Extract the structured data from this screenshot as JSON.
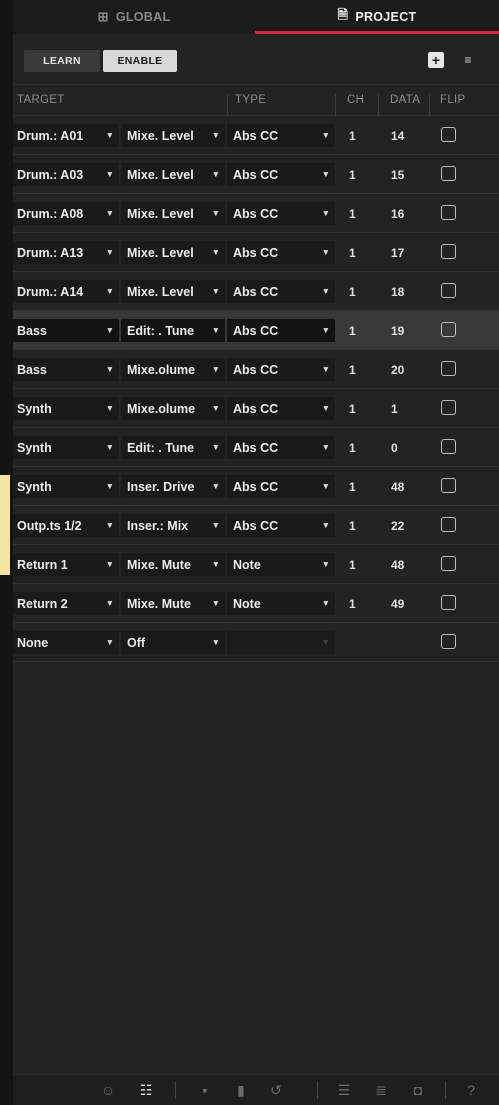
{
  "tabs": [
    {
      "label": "GLOBAL",
      "icon": "grid-icon",
      "active": false
    },
    {
      "label": "PROJECT",
      "icon": "project-file-icon",
      "active": true
    }
  ],
  "accent_color": "#e0233b",
  "toolbar": {
    "learn_label": "LEARN",
    "enable_label": "ENABLE",
    "add_icon": "+",
    "sort_icon": "≡"
  },
  "columns": {
    "target": "TARGET",
    "type": "TYPE",
    "ch": "CH",
    "data": "DATA",
    "flip": "FLIP"
  },
  "rows": [
    {
      "target": "Drum.: A01",
      "param": "Mixe. Level",
      "type": "Abs CC",
      "ch": "1",
      "data": "14",
      "flip": false
    },
    {
      "target": "Drum.: A03",
      "param": "Mixe. Level",
      "type": "Abs CC",
      "ch": "1",
      "data": "15",
      "flip": false
    },
    {
      "target": "Drum.: A08",
      "param": "Mixe. Level",
      "type": "Abs CC",
      "ch": "1",
      "data": "16",
      "flip": false
    },
    {
      "target": "Drum.: A13",
      "param": "Mixe. Level",
      "type": "Abs CC",
      "ch": "1",
      "data": "17",
      "flip": false
    },
    {
      "target": "Drum.: A14",
      "param": "Mixe. Level",
      "type": "Abs CC",
      "ch": "1",
      "data": "18",
      "flip": false
    },
    {
      "target": "Bass",
      "param": "Edit: . Tune",
      "type": "Abs CC",
      "ch": "1",
      "data": "19",
      "flip": false,
      "selected": true
    },
    {
      "target": "Bass",
      "param": "Mixe.olume",
      "type": "Abs CC",
      "ch": "1",
      "data": "20",
      "flip": false
    },
    {
      "target": "Synth",
      "param": "Mixe.olume",
      "type": "Abs CC",
      "ch": "1",
      "data": "1",
      "flip": false
    },
    {
      "target": "Synth",
      "param": "Edit: . Tune",
      "type": "Abs CC",
      "ch": "1",
      "data": "0",
      "flip": false
    },
    {
      "target": "Synth",
      "param": "Inser. Drive",
      "type": "Abs CC",
      "ch": "1",
      "data": "48",
      "flip": false
    },
    {
      "target": "Outp.ts 1/2",
      "param": "Inser.: Mix",
      "type": "Abs CC",
      "ch": "1",
      "data": "22",
      "flip": false
    },
    {
      "target": "Return 1",
      "param": "Mixe. Mute",
      "type": "Note",
      "ch": "1",
      "data": "48",
      "flip": false
    },
    {
      "target": "Return 2",
      "param": "Mixe. Mute",
      "type": "Note",
      "ch": "1",
      "data": "49",
      "flip": false
    },
    {
      "target": "None",
      "param": "Off",
      "type": "",
      "ch": "",
      "data": "",
      "flip": false
    }
  ],
  "bottom_icons": [
    {
      "name": "smiley-icon",
      "glyph": "☺"
    },
    {
      "name": "mixer-icon",
      "glyph": "☷",
      "active": true
    },
    {
      "name": "file-icon",
      "glyph": "▪"
    },
    {
      "name": "channel-strip-icon",
      "glyph": "▮"
    },
    {
      "name": "history-icon",
      "glyph": "↺"
    },
    {
      "name": "list-view-icon",
      "glyph": "☰"
    },
    {
      "name": "browser-icon",
      "glyph": "≣"
    },
    {
      "name": "sampler-icon",
      "glyph": "◘"
    },
    {
      "name": "help-icon",
      "glyph": "?"
    }
  ]
}
